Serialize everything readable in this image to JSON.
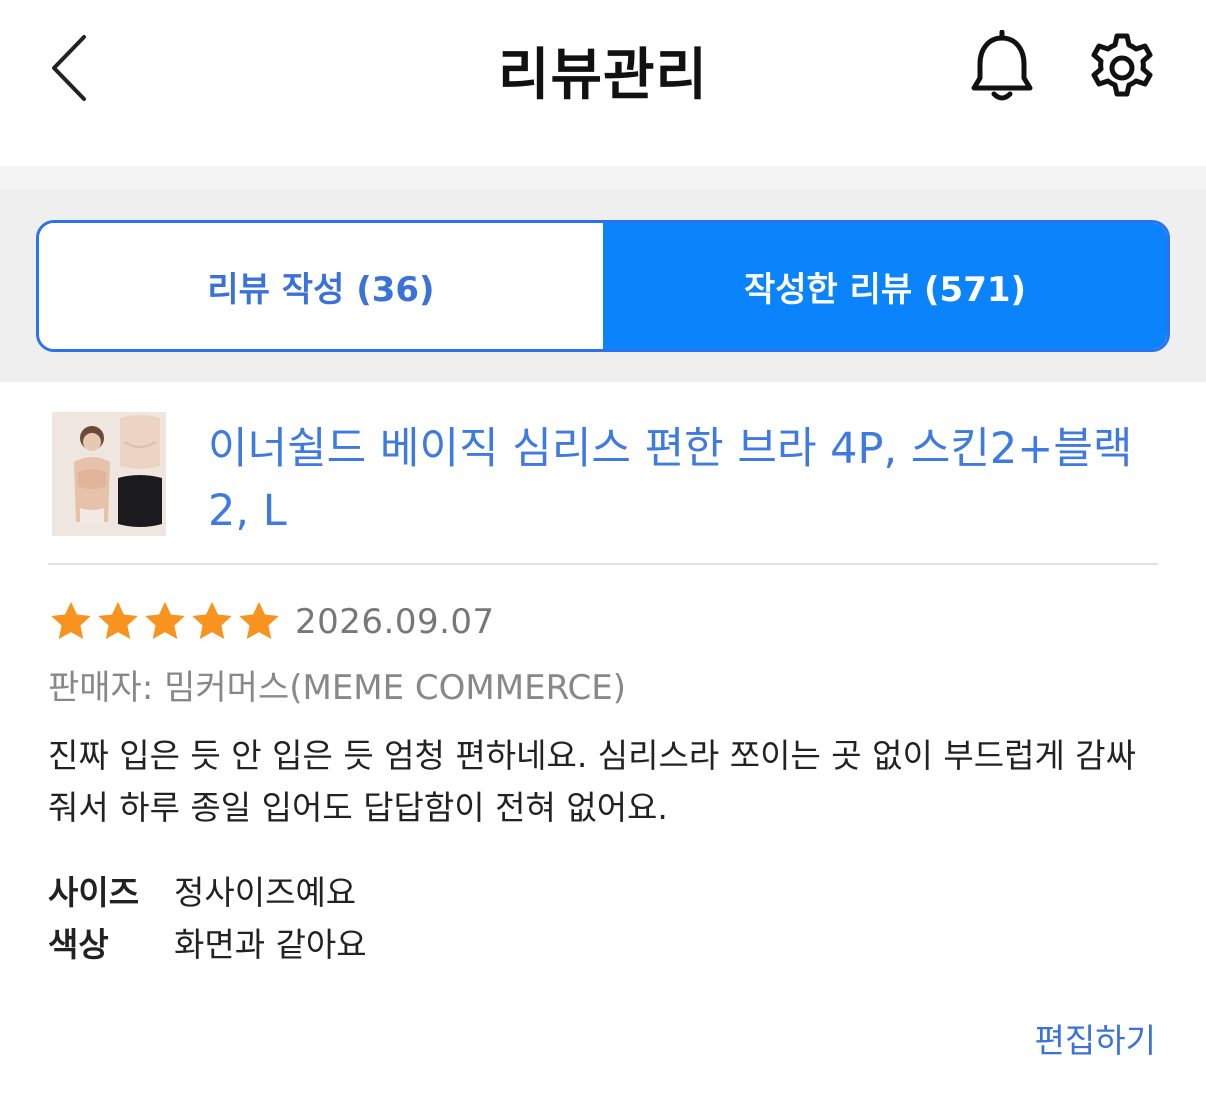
{
  "header": {
    "title": "리뷰관리",
    "back_icon": "chevron-left-icon",
    "bell_icon": "bell-icon",
    "settings_icon": "gear-icon"
  },
  "tabs": [
    {
      "label": "리뷰 작성 (36)",
      "active": false
    },
    {
      "label": "작성한 리뷰 (571)",
      "active": true
    }
  ],
  "review": {
    "product_name": "이너쉴드 베이직 심리스 편한 브라 4P, 스킨2+블랙 2, L",
    "rating": 5,
    "rating_max": 5,
    "date": "2026.09.07",
    "seller": "판매자: 밈커머스(MEME COMMERCE)",
    "text": "진짜 입은 듯 안 입은 듯 엄청 편하네요. 심리스라 쪼이는 곳 없이 부드럽게 감싸줘서 하루 종일 입어도 답답함이 전혀 없어요.",
    "attributes": [
      {
        "label": "사이즈",
        "value": "정사이즈예요"
      },
      {
        "label": "색상",
        "value": "화면과 같아요"
      }
    ],
    "edit_label": "편집하기"
  },
  "colors": {
    "accent": "#0b83fb",
    "link": "#3a72d8",
    "star": "#f7931e"
  }
}
